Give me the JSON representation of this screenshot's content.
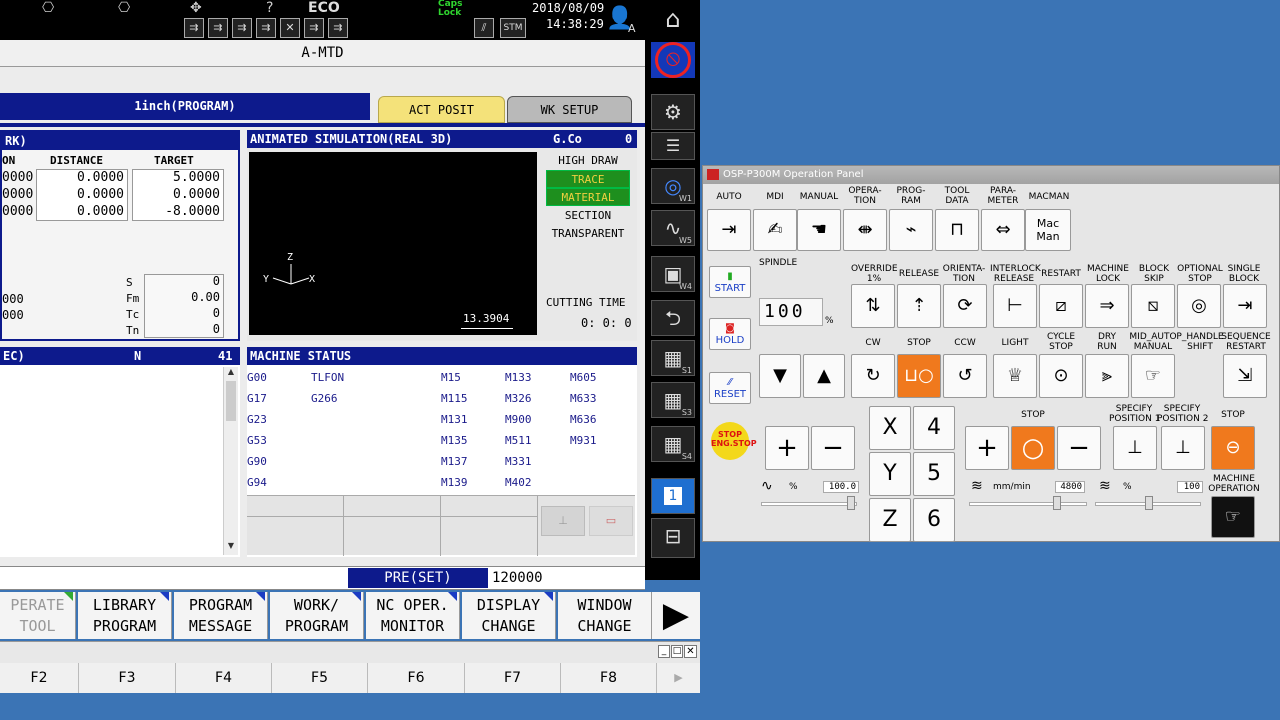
{
  "topbar": {
    "caps_lock": "Caps\nLock",
    "eco": "ECO",
    "date": "2018/08/09",
    "time": "14:38:29",
    "user": "A"
  },
  "window_title": "A-MTD",
  "program_band": "1inch(PROGRAM)",
  "tabs": {
    "act_posit": "ACT POSIT",
    "wk_setup": "WK SETUP"
  },
  "position": {
    "header": "RK)",
    "col_position": "ON",
    "col_distance": "DISTANCE",
    "col_target": "TARGET",
    "rows": [
      {
        "pos": "0000",
        "distance": "0.0000",
        "target": "5.0000"
      },
      {
        "pos": "0000",
        "distance": "0.0000",
        "target": "0.0000"
      },
      {
        "pos": "0000",
        "distance": "0.0000",
        "target": "-8.0000"
      }
    ],
    "extra_left": [
      "000",
      "000"
    ],
    "s_label": "S",
    "s_value": "0",
    "fm_label": "Fm",
    "fm_value": "0.00",
    "tc_label": "Tc",
    "tc_value": "0",
    "tn_label": "Tn",
    "tn_value": "0"
  },
  "simulation": {
    "title": "ANIMATED SIMULATION(REAL 3D)",
    "gco": "G.Co",
    "gco_value": "0",
    "buttons": [
      "HIGH DRAW",
      "TRACE",
      "MATERIAL",
      "SECTION",
      "TRANSPARENT"
    ],
    "axis_z": "Z",
    "axis_y": "Y",
    "axis_x": "X",
    "scale": "13.3904",
    "cutting_time_label": "CUTTING TIME",
    "cutting_time_value": "0: 0: 0"
  },
  "program_list": {
    "header": "EC)",
    "n_label": "N",
    "n_value": "41"
  },
  "machine_status": {
    "title": "MACHINE STATUS",
    "gcodes": [
      "G00",
      "G17",
      "G23",
      "G53",
      "G90",
      "G94"
    ],
    "col2": [
      "TLFON",
      "G266"
    ],
    "col3": [
      "M15",
      "M115",
      "M131",
      "M135",
      "M137",
      "M139"
    ],
    "col4": [
      "M133",
      "M326",
      "M900",
      "M511",
      "M331",
      "M402"
    ],
    "col5": [
      "M605",
      "M633",
      "M636",
      "M931"
    ]
  },
  "preset": {
    "label": "PRE(SET)",
    "value": "120000"
  },
  "fkeys": [
    {
      "l1": "PERATE",
      "l2": "TOOL"
    },
    {
      "l1": "LIBRARY",
      "l2": "PROGRAM"
    },
    {
      "l1": "PROGRAM",
      "l2": "MESSAGE"
    },
    {
      "l1": "WORK/",
      "l2": "PROGRAM"
    },
    {
      "l1": "NC OPER.",
      "l2": "MONITOR"
    },
    {
      "l1": "DISPLAY",
      "l2": "CHANGE"
    },
    {
      "l1": "WINDOW",
      "l2": "CHANGE"
    }
  ],
  "fnums": [
    "F2",
    "F3",
    "F4",
    "F5",
    "F6",
    "F7",
    "F8"
  ],
  "right_side": {
    "w1": "W1",
    "w5": "W5",
    "w4": "W4",
    "s1": "S1",
    "s3": "S3",
    "s4": "S4",
    "one": "1"
  },
  "op_panel": {
    "title": "OSP-P300M Operation Panel",
    "modes": [
      "AUTO",
      "MDI",
      "MANUAL",
      "OPERA-\nTION",
      "PROG-\nRAM",
      "TOOL\nDATA",
      "PARA-\nMETER",
      "MACMAN"
    ],
    "mac_man": "Mac\nMan",
    "start": "START",
    "hold": "HOLD",
    "reset": "RESET",
    "estop_top": "STOP",
    "estop_bot": "ENG.STOP",
    "spindle": "SPINDLE",
    "spindle_digits": [
      "1",
      "0",
      "0"
    ],
    "pct": "%",
    "override": "OVERRIDE\n1%",
    "release": "RELEASE",
    "orientation": "ORIENTA-\nTION",
    "interlock": "INTERLOCK\nRELEASE",
    "restart": "RESTART",
    "machine_lock": "MACHINE\nLOCK",
    "block_skip": "BLOCK\nSKIP",
    "optional_stop": "OPTIONAL\nSTOP",
    "single_block": "SINGLE\nBLOCK",
    "cw": "CW",
    "stop": "STOP",
    "ccw": "CCW",
    "light": "LIGHT",
    "cycle_stop": "CYCLE\nSTOP",
    "dry_run": "DRY\nRUN",
    "mid_auto": "MID_AUTO\nMANUAL",
    "p_handle": "P_HANDLE\nSHIFT",
    "seq_restart": "SEQUENCE\nRESTART",
    "plus": "+",
    "minus": "−",
    "axes": [
      "X",
      "Y",
      "Z"
    ],
    "nums": [
      "4",
      "5",
      "6"
    ],
    "stop2": "STOP",
    "spec1": "SPECIFY\nPOSITION 1",
    "spec2": "SPECIFY\nPOSITION 2",
    "stop3": "STOP",
    "pct_label": "%",
    "slider1": "100.0",
    "feed_label": "mm/min",
    "feed_value": "4800",
    "rapid_label": "%",
    "rapid_value": "100",
    "machine_op": "MACHINE\nOPERATION"
  }
}
